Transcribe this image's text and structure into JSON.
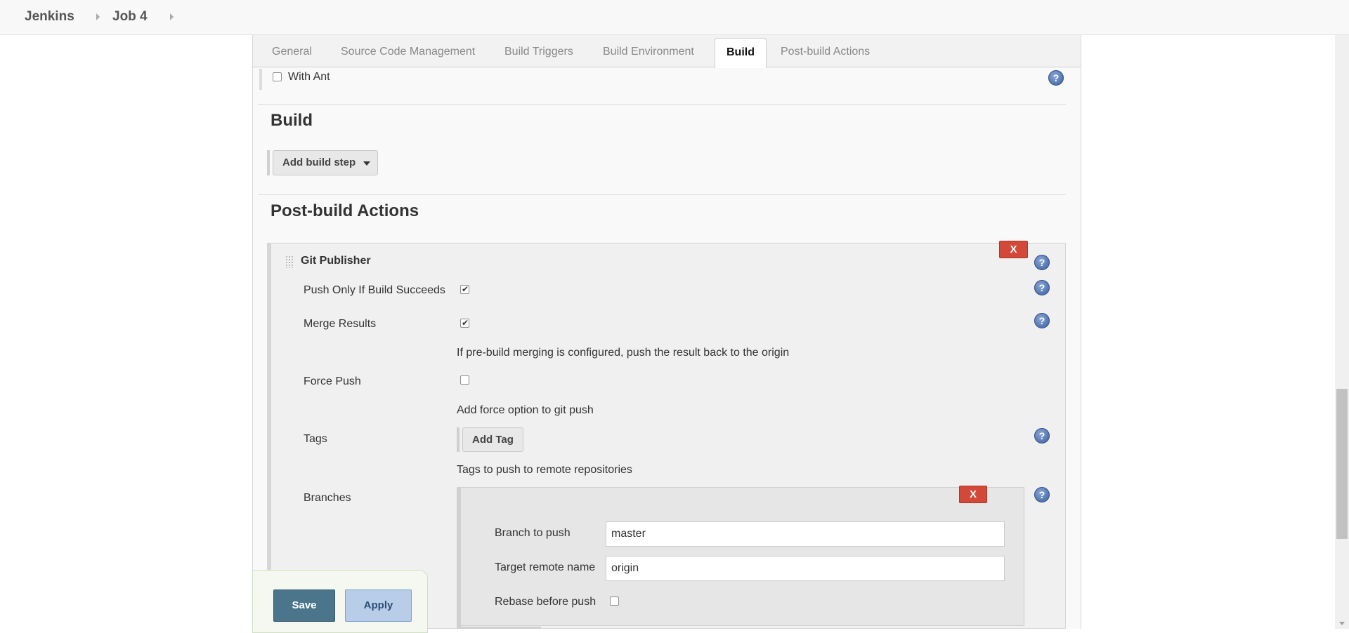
{
  "breadcrumb": {
    "items": [
      "Jenkins",
      "Job 4"
    ]
  },
  "tabs": [
    {
      "label": "General"
    },
    {
      "label": "Source Code Management"
    },
    {
      "label": "Build Triggers"
    },
    {
      "label": "Build Environment"
    },
    {
      "label": "Build"
    },
    {
      "label": "Post-build Actions"
    }
  ],
  "active_tab": "Build",
  "build_environment": {
    "with_ant_label": "With Ant",
    "with_ant_checked": false
  },
  "build": {
    "title": "Build",
    "add_step_label": "Add build step"
  },
  "post_build": {
    "title": "Post-build Actions",
    "delete_label": "X",
    "git_publisher": {
      "title": "Git Publisher",
      "push_only_label": "Push Only If Build Succeeds",
      "push_only_checked": true,
      "merge_results_label": "Merge Results",
      "merge_results_checked": true,
      "merge_results_desc": "If pre-build merging is configured, push the result back to the origin",
      "force_push_label": "Force Push",
      "force_push_checked": false,
      "force_push_desc": "Add force option to git push",
      "tags_label": "Tags",
      "add_tag_label": "Add Tag",
      "tags_desc": "Tags to push to remote repositories",
      "branches_label": "Branches",
      "branch": {
        "delete_label": "X",
        "branch_to_push_label": "Branch to push",
        "branch_to_push_value": "master",
        "target_remote_label": "Target remote name",
        "target_remote_value": "origin",
        "rebase_label": "Rebase before push",
        "rebase_checked": false
      }
    }
  },
  "actions": {
    "save_label": "Save",
    "apply_label": "Apply"
  },
  "help_glyph": "?",
  "colors": {
    "delete_red": "#d24939",
    "save_teal": "#4b758b",
    "apply_blue": "#b8cee8",
    "help_blue": "#3a5f9e"
  }
}
